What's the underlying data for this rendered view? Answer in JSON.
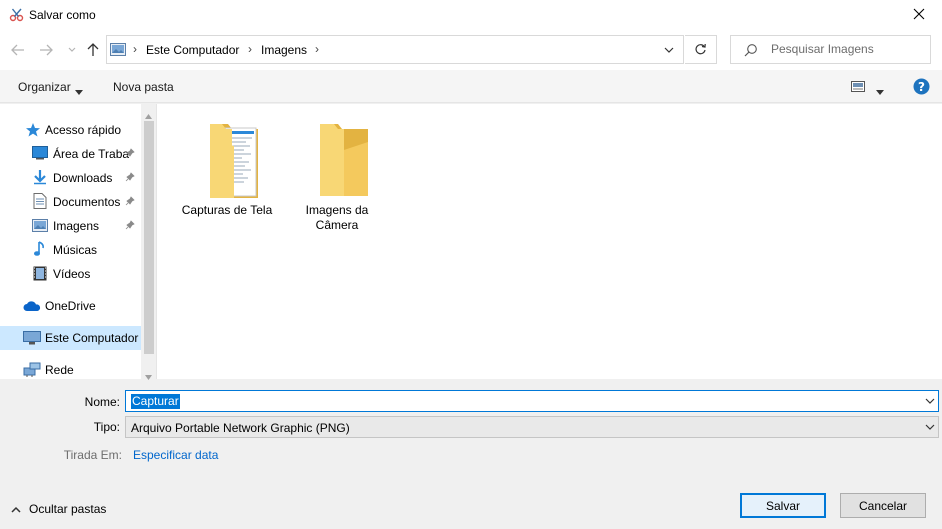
{
  "window": {
    "title": "Salvar como",
    "icon": "snipping-tool-icon"
  },
  "address": {
    "crumbs": [
      "Este Computador",
      "Imagens"
    ]
  },
  "search": {
    "placeholder": "Pesquisar Imagens"
  },
  "toolbar": {
    "organize": "Organizar",
    "new_folder": "Nova pasta"
  },
  "nav": {
    "quick_access": "Acesso rápido",
    "desktop": "Área de Traba",
    "downloads": "Downloads",
    "documents": "Documentos",
    "pictures": "Imagens",
    "music": "Músicas",
    "videos": "Vídeos",
    "onedrive": "OneDrive",
    "this_pc": "Este Computador",
    "network": "Rede"
  },
  "folders": [
    {
      "name_line1": "Capturas de Tela",
      "name_line2": ""
    },
    {
      "name_line1": "Imagens da",
      "name_line2": "Câmera"
    }
  ],
  "form": {
    "name_label": "Nome:",
    "name_value": "Capturar",
    "type_label": "Tipo:",
    "type_value": "Arquivo Portable Network Graphic (PNG)",
    "taken_label": "Tirada Em:",
    "taken_link": "Especificar data"
  },
  "footer": {
    "hide_folders": "Ocultar pastas",
    "save": "Salvar",
    "cancel": "Cancelar"
  },
  "colors": {
    "accent": "#0078d7",
    "folder": "#f8d775",
    "selected": "#cce8ff",
    "link": "#0066cc"
  }
}
